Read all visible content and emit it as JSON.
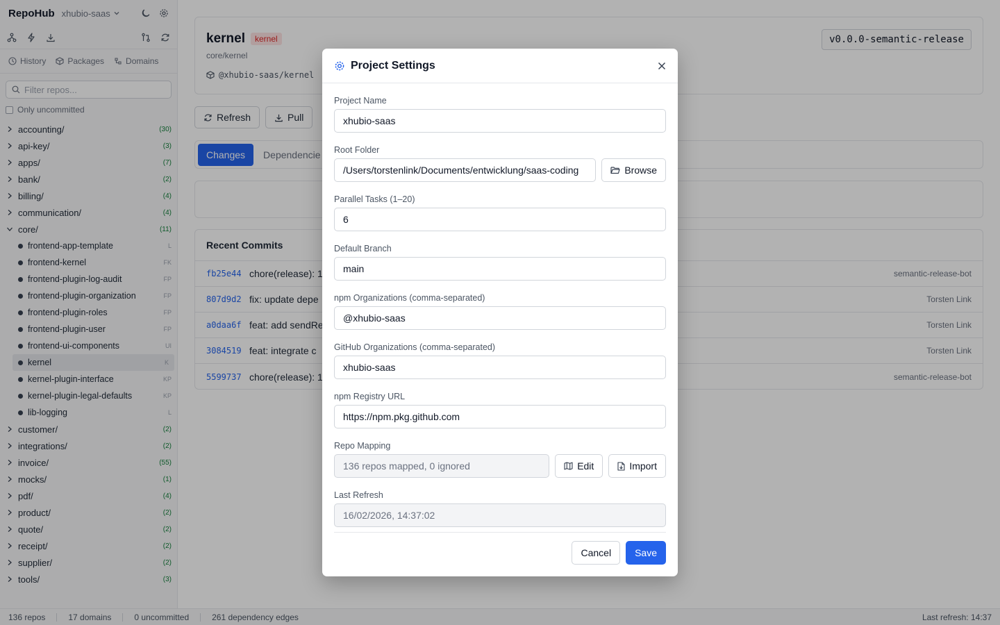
{
  "app": {
    "brand": "RepoHub",
    "project": "xhubio-saas"
  },
  "sidebar": {
    "nav": [
      {
        "label": "History"
      },
      {
        "label": "Packages"
      },
      {
        "label": "Domains"
      }
    ],
    "filter_placeholder": "Filter repos...",
    "only_uncommitted": "Only uncommitted",
    "folders_top": [
      {
        "name": "accounting/",
        "count": "(30)"
      },
      {
        "name": "api-key/",
        "count": "(3)"
      },
      {
        "name": "apps/",
        "count": "(7)"
      },
      {
        "name": "bank/",
        "count": "(2)"
      },
      {
        "name": "billing/",
        "count": "(4)"
      },
      {
        "name": "communication/",
        "count": "(4)"
      },
      {
        "name": "core/",
        "count": "(11)"
      }
    ],
    "core_children": [
      {
        "name": "frontend-app-template",
        "abbr": "L"
      },
      {
        "name": "frontend-kernel",
        "abbr": "FK"
      },
      {
        "name": "frontend-plugin-log-audit",
        "abbr": "FP"
      },
      {
        "name": "frontend-plugin-organization",
        "abbr": "FP"
      },
      {
        "name": "frontend-plugin-roles",
        "abbr": "FP"
      },
      {
        "name": "frontend-plugin-user",
        "abbr": "FP"
      },
      {
        "name": "frontend-ui-components",
        "abbr": "UI"
      },
      {
        "name": "kernel",
        "abbr": "K"
      },
      {
        "name": "kernel-plugin-interface",
        "abbr": "KP"
      },
      {
        "name": "kernel-plugin-legal-defaults",
        "abbr": "KP"
      },
      {
        "name": "lib-logging",
        "abbr": "L"
      }
    ],
    "folders_bottom": [
      {
        "name": "customer/",
        "count": "(2)"
      },
      {
        "name": "integrations/",
        "count": "(2)"
      },
      {
        "name": "invoice/",
        "count": "(55)"
      },
      {
        "name": "mocks/",
        "count": "(1)"
      },
      {
        "name": "pdf/",
        "count": "(4)"
      },
      {
        "name": "product/",
        "count": "(2)"
      },
      {
        "name": "quote/",
        "count": "(2)"
      },
      {
        "name": "receipt/",
        "count": "(2)"
      },
      {
        "name": "supplier/",
        "count": "(2)"
      },
      {
        "name": "tools/",
        "count": "(3)"
      }
    ]
  },
  "repo": {
    "name": "kernel",
    "badge": "kernel",
    "path": "core/kernel",
    "package": "@xhubio-saas/kernel",
    "version": "v0.0.0-semantic-release"
  },
  "actions": {
    "refresh": "Refresh",
    "pull": "Pull"
  },
  "tabs": {
    "changes": "Changes",
    "dependencies": "Dependencie"
  },
  "commits": {
    "title": "Recent Commits",
    "rows": [
      {
        "hash": "fb25e44",
        "msg": "chore(release): 1",
        "author": "semantic-release-bot"
      },
      {
        "hash": "807d9d2",
        "msg": "fix: update depe",
        "author": "Torsten Link"
      },
      {
        "hash": "a0daa6f",
        "msg": "feat: add sendRe",
        "author": "Torsten Link"
      },
      {
        "hash": "3084519",
        "msg": "feat: integrate c",
        "author": "Torsten Link"
      },
      {
        "hash": "5599737",
        "msg": "chore(release): 1",
        "author": "semantic-release-bot"
      }
    ]
  },
  "status": {
    "repos": "136 repos",
    "domains": "17 domains",
    "uncommitted": "0 uncommitted",
    "edges": "261 dependency edges",
    "last_refresh": "Last refresh: 14:37"
  },
  "modal": {
    "title": "Project Settings",
    "project_name": {
      "label": "Project Name",
      "value": "xhubio-saas"
    },
    "root_folder": {
      "label": "Root Folder",
      "value": "/Users/torstenlink/Documents/entwicklung/saas-coding",
      "button": "Browse"
    },
    "parallel_tasks": {
      "label": "Parallel Tasks (1–20)",
      "value": "6"
    },
    "default_branch": {
      "label": "Default Branch",
      "value": "main"
    },
    "npm_orgs": {
      "label": "npm Organizations (comma-separated)",
      "value": "@xhubio-saas"
    },
    "github_orgs": {
      "label": "GitHub Organizations (comma-separated)",
      "value": "xhubio-saas"
    },
    "npm_registry": {
      "label": "npm Registry URL",
      "value": "https://npm.pkg.github.com"
    },
    "repo_mapping": {
      "label": "Repo Mapping",
      "value": "136 repos mapped, 0 ignored",
      "edit": "Edit",
      "import": "Import"
    },
    "last_refresh": {
      "label": "Last Refresh",
      "value": "16/02/2026, 14:37:02"
    },
    "cancel": "Cancel",
    "save": "Save"
  },
  "colors": {
    "accent": "#2563eb",
    "badge_red": "#dc2626",
    "count_green": "#15803d"
  }
}
